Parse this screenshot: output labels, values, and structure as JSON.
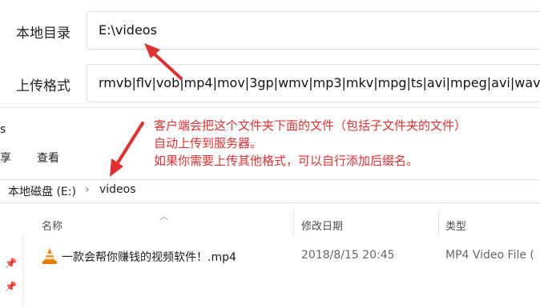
{
  "config": {
    "local_dir_label": "本地目录",
    "local_dir_value": "E:\\videos",
    "upload_format_label": "上传格式",
    "upload_format_value": "rmvb|flv|vob|mp4|mov|3gp|wmv|mp3|mkv|mpg|ts|avi|mpeg|avi|wav"
  },
  "explorer": {
    "title_fragment": "s",
    "menu": [
      "享",
      "查看"
    ],
    "breadcrumb": {
      "drive": "本地磁盘 (E:)",
      "separator": "›",
      "folder": "videos"
    },
    "columns": {
      "name": "名称",
      "modified": "修改日期",
      "type": "类型"
    },
    "rows": [
      {
        "name": "一款会帮你赚钱的视频软件！.mp4",
        "modified": "2018/8/15 20:45",
        "type": "MP4 Video File (",
        "icon": "vlc-cone-icon"
      }
    ]
  },
  "annotation": {
    "line1": "客户端会把这个文件夹下面的文件（包括子文件夹的文件）",
    "line2": "自动上传到服务器。",
    "line3": "如果你需要上传其他格式，可以自行添加后缀名。",
    "color": "#e03030"
  }
}
